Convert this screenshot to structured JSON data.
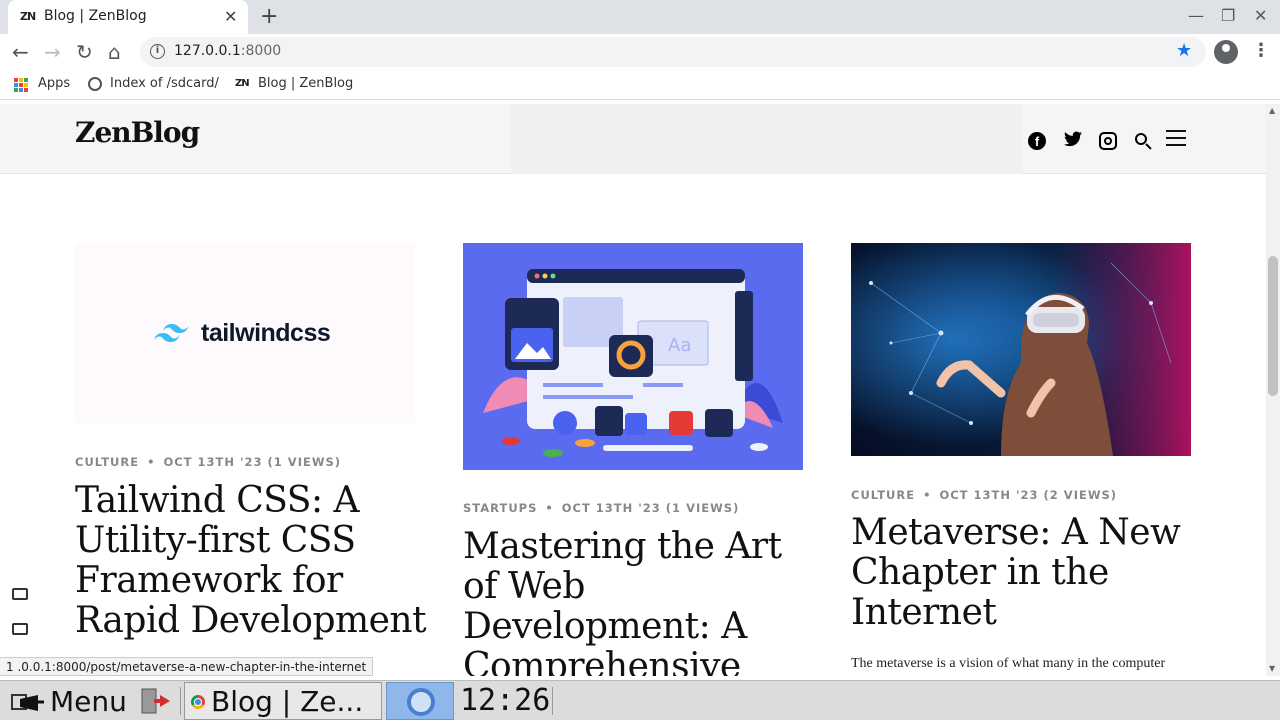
{
  "browser": {
    "tab": {
      "favicon": "ZN",
      "title": "Blog | ZenBlog",
      "close": "✕"
    },
    "new_tab": "+",
    "window_controls": {
      "minimize": "—",
      "restore": "❐",
      "close": "✕"
    },
    "nav": {
      "back": "←",
      "forward": "→",
      "reload": "↻",
      "home": "⌂"
    },
    "url_host": "127.0.0.1",
    "url_port": ":8000",
    "bookmarks": [
      {
        "label": "Apps"
      },
      {
        "label": "Index of /sdcard/"
      },
      {
        "label": "Blog | ZenBlog"
      }
    ],
    "bookmark_favicon": "ZN"
  },
  "site": {
    "logo": "ZenBlog",
    "social": {
      "facebook": "f",
      "twitter": "🐦"
    }
  },
  "posts": [
    {
      "image_text": "tailwindcss",
      "category": "CULTURE",
      "date": "OCT 13TH '23 (1 VIEWS)",
      "title": "Tailwind CSS: A Utility-first CSS Framework for Rapid Development"
    },
    {
      "image_text": "Aa",
      "category": "STARTUPS",
      "date": "OCT 13TH '23 (1 VIEWS)",
      "title": "Mastering the Art of Web Development: A Comprehensive Guide"
    },
    {
      "category": "CULTURE",
      "date": "OCT 13TH '23 (2 VIEWS)",
      "title": "Metaverse: A New Chapter in the Internet",
      "excerpt": "The metaverse is a vision of what many in the computer"
    }
  ],
  "meta_separator": "•",
  "status_url": "1 .0.0.1:8000/post/metaverse-a-new-chapter-in-the-internet",
  "taskbar": {
    "menu_label": "Menu",
    "task_title": "Blog | Ze...",
    "clock": "12:26"
  }
}
